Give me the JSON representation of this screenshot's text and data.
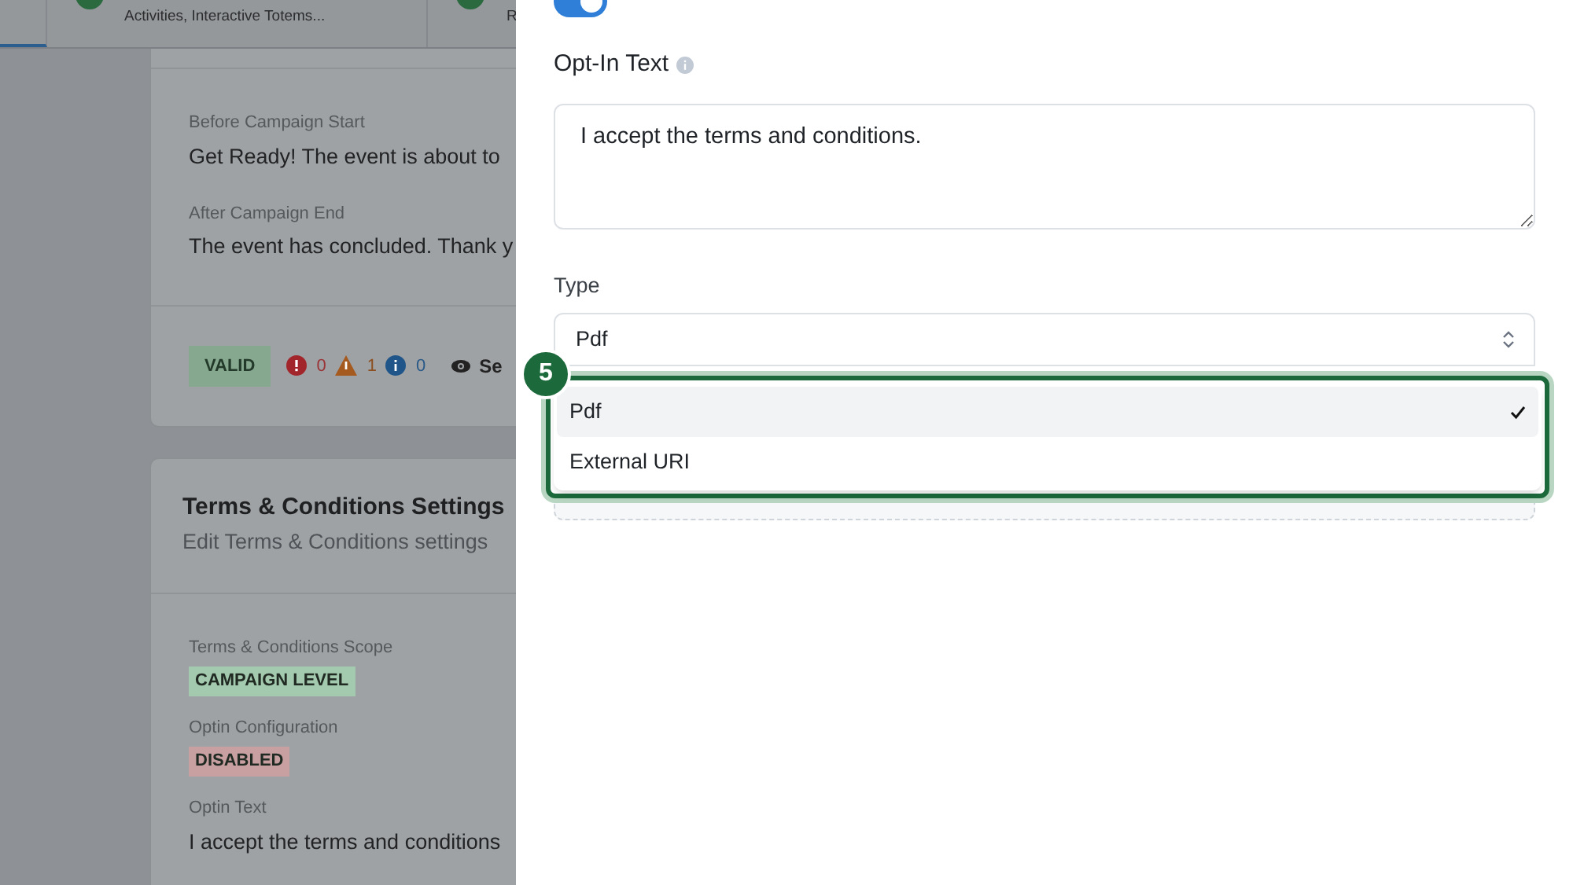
{
  "tabs": [
    {
      "selected": true
    },
    {
      "subtitle": "Activities, Interactive Totems...",
      "selected": false
    },
    {
      "subtitle": "R",
      "selected": false
    }
  ],
  "messages_card": {
    "fields": [
      {
        "label": "Before Campaign Start",
        "value": "Get Ready! The event is about to"
      },
      {
        "label": "After Campaign End",
        "value": "The event has concluded. Thank y"
      }
    ],
    "status": "VALID",
    "errors": "0",
    "warnings": "1",
    "infos": "0",
    "action": "Se"
  },
  "terms_card": {
    "title": "Terms & Conditions Settings",
    "subtitle": "Edit Terms & Conditions settings",
    "fields": [
      {
        "kind": "tag",
        "label": "Terms & Conditions Scope",
        "value": "CAMPAIGN LEVEL",
        "color": "#a3c9ae"
      },
      {
        "kind": "tag",
        "label": "Optin Configuration",
        "value": "DISABLED",
        "color": "#c9a0a2"
      },
      {
        "kind": "text",
        "label": "Optin Text",
        "value": "I accept the terms and conditions"
      }
    ]
  },
  "drawer": {
    "toggle": {
      "on": true
    },
    "optin_label": "Opt-In Text",
    "optin_value": "I accept the terms and conditions.",
    "type_label": "Type",
    "type_value": "Pdf",
    "options": [
      {
        "label": "Pdf",
        "selected": true
      },
      {
        "label": "External URI",
        "selected": false
      }
    ],
    "step_badge": "5"
  }
}
